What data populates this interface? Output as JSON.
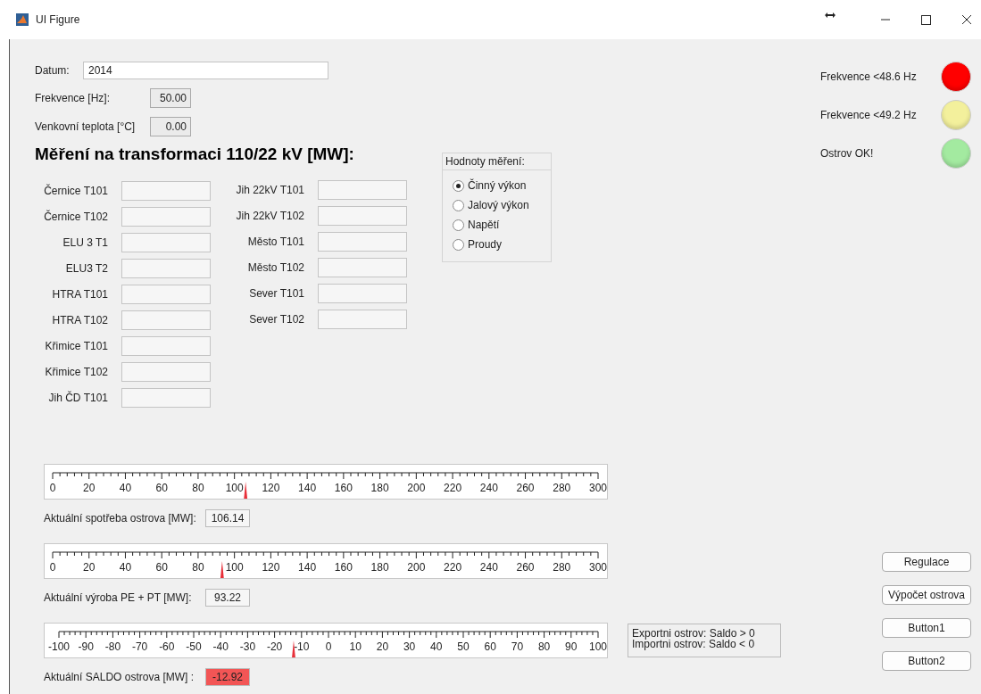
{
  "window": {
    "title": "UI Figure"
  },
  "datum": {
    "label": "Datum:",
    "value": "2014"
  },
  "readouts": [
    {
      "label": "Frekvence [Hz]:",
      "value": "50.00"
    },
    {
      "label": "Venkovní teplota [°C]",
      "value": "0.00"
    }
  ],
  "heading": "Měření na transformaci 110/22 kV [MW]:",
  "measurement_columns": [
    [
      {
        "label": "Černice T101"
      },
      {
        "label": "Černice T102"
      },
      {
        "label": "ELU 3 T1"
      },
      {
        "label": "ELU3 T2"
      },
      {
        "label": "HTRA T101"
      },
      {
        "label": "HTRA T102"
      },
      {
        "label": "Křimice T101"
      },
      {
        "label": "Křimice T102"
      },
      {
        "label": "Jih ČD T101"
      }
    ],
    [
      {
        "label": "Jih 22kV T101"
      },
      {
        "label": "Jih 22kV T102"
      },
      {
        "label": "Město T101"
      },
      {
        "label": "Město T102"
      },
      {
        "label": "Sever T101"
      },
      {
        "label": "Sever T102"
      }
    ]
  ],
  "measurement_type": {
    "title": "Hodnoty měření:",
    "options": [
      {
        "label": "Činný výkon",
        "selected": true
      },
      {
        "label": "Jalový výkon",
        "selected": false
      },
      {
        "label": "Napětí",
        "selected": false
      },
      {
        "label": "Proudy",
        "selected": false
      }
    ]
  },
  "gauges": [
    {
      "ticks": [
        "0",
        "20",
        "40",
        "60",
        "80",
        "100",
        "120",
        "140",
        "160",
        "180",
        "200",
        "220",
        "240",
        "260",
        "280",
        "300"
      ],
      "level": 0.3538,
      "label": "Aktuální spotřeba ostrova [MW]:",
      "value": "106.14",
      "alert": false
    },
    {
      "ticks": [
        "0",
        "20",
        "40",
        "60",
        "80",
        "100",
        "120",
        "140",
        "160",
        "180",
        "200",
        "220",
        "240",
        "260",
        "280",
        "300"
      ],
      "level": 0.3107,
      "label": "Aktuální výroba PE + PT [MW]:",
      "value": "93.22",
      "alert": false
    },
    {
      "ticks": [
        "-100",
        "-90",
        "-80",
        "-70",
        "-60",
        "-50",
        "-40",
        "-30",
        "-20",
        "-10",
        "0",
        "10",
        "20",
        "30",
        "40",
        "50",
        "60",
        "70",
        "80",
        "90",
        "100"
      ],
      "level": 0.4354,
      "label": "Aktuální SALDO ostrova [MW] :",
      "value": "-12.92",
      "alert": true
    }
  ],
  "legend": [
    "Exportni ostrov: Saldo > 0",
    "Importni ostrov: Saldo < 0"
  ],
  "lamps": [
    {
      "label": "Frekvence <48.6 Hz",
      "color": "#ff0000"
    },
    {
      "label": "Frekvence <49.2 Hz",
      "color": "#f3f09c"
    },
    {
      "label": "Ostrov OK!",
      "color": "#a3eaa0"
    }
  ],
  "buttons": [
    "Regulace",
    "Výpočet ostrova",
    "Button1",
    "Button2"
  ]
}
